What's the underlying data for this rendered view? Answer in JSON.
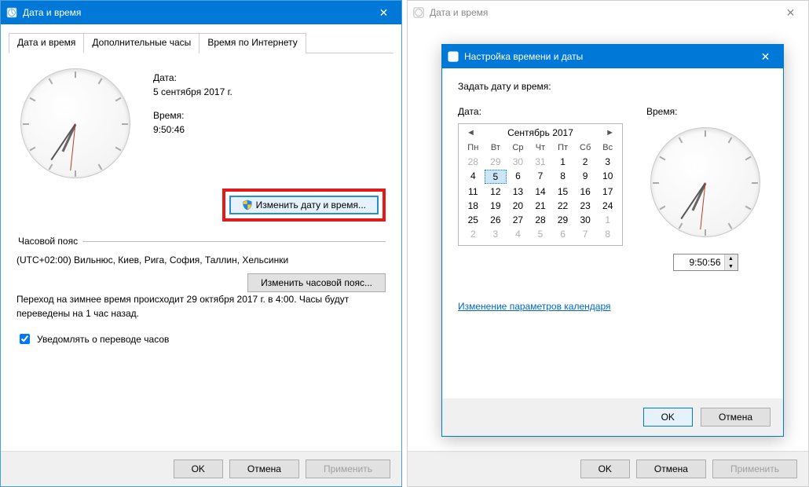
{
  "win1": {
    "title": "Дата и время",
    "tabs": [
      "Дата и время",
      "Дополнительные часы",
      "Время по Интернету"
    ],
    "date_label": "Дата:",
    "date_value": "5 сентября 2017 г.",
    "time_label": "Время:",
    "time_value": "9:50:46",
    "change_btn": "Изменить дату и время...",
    "tz_group": "Часовой пояс",
    "tz_value": "(UTC+02:00) Вильнюс, Киев, Рига, София, Таллин, Хельсинки",
    "tz_btn": "Изменить часовой пояс...",
    "dst_text": "Переход на зимнее время происходит 29 октября 2017 г. в 4:00. Часы будут переведены на 1 час назад.",
    "notify_label": "Уведомлять о переводе часов",
    "ok": "OK",
    "cancel": "Отмена",
    "apply": "Применить"
  },
  "win2": {
    "title": "Дата и время",
    "ok": "OK",
    "cancel": "Отмена",
    "apply": "Применить"
  },
  "modal": {
    "title": "Настройка времени и даты",
    "set_label": "Задать дату и время:",
    "date_hdr": "Дата:",
    "time_hdr": "Время:",
    "month": "Сентябрь 2017",
    "dow": [
      "Пн",
      "Вт",
      "Ср",
      "Чт",
      "Пт",
      "Сб",
      "Вс"
    ],
    "weeks": [
      [
        {
          "d": 28,
          "o": 1
        },
        {
          "d": 29,
          "o": 1
        },
        {
          "d": 30,
          "o": 1
        },
        {
          "d": 31,
          "o": 1
        },
        {
          "d": 1
        },
        {
          "d": 2
        },
        {
          "d": 3
        }
      ],
      [
        {
          "d": 4
        },
        {
          "d": 5,
          "sel": 1
        },
        {
          "d": 6
        },
        {
          "d": 7
        },
        {
          "d": 8
        },
        {
          "d": 9
        },
        {
          "d": 10
        }
      ],
      [
        {
          "d": 11
        },
        {
          "d": 12
        },
        {
          "d": 13
        },
        {
          "d": 14
        },
        {
          "d": 15
        },
        {
          "d": 16
        },
        {
          "d": 17
        }
      ],
      [
        {
          "d": 18
        },
        {
          "d": 19
        },
        {
          "d": 20
        },
        {
          "d": 21
        },
        {
          "d": 22
        },
        {
          "d": 23
        },
        {
          "d": 24
        }
      ],
      [
        {
          "d": 25
        },
        {
          "d": 26
        },
        {
          "d": 27
        },
        {
          "d": 28
        },
        {
          "d": 29
        },
        {
          "d": 30
        },
        {
          "d": 1,
          "o": 1
        }
      ],
      [
        {
          "d": 2,
          "o": 1
        },
        {
          "d": 3,
          "o": 1
        },
        {
          "d": 4,
          "o": 1
        },
        {
          "d": 5,
          "o": 1
        },
        {
          "d": 6,
          "o": 1
        },
        {
          "d": 7,
          "o": 1
        },
        {
          "d": 8,
          "o": 1
        }
      ]
    ],
    "time_value": "9:50:56",
    "link": "Изменение параметров календаря",
    "ok": "OK",
    "cancel": "Отмена"
  },
  "clock": {
    "h_deg": 205,
    "m_deg": 214,
    "s_deg": 186
  }
}
